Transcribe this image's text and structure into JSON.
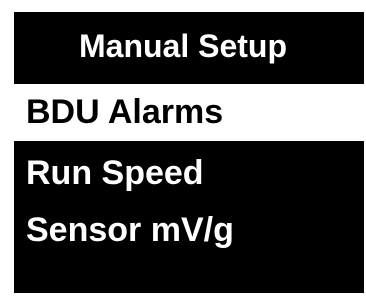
{
  "screen": {
    "title": "Manual Setup",
    "menu": [
      {
        "label": "BDU Alarms",
        "selected": true
      },
      {
        "label": "Run Speed",
        "selected": false
      },
      {
        "label": "Sensor mV/g",
        "selected": false
      }
    ]
  },
  "colors": {
    "background": "#000000",
    "text": "#ffffff",
    "highlight_background": "#ffffff",
    "highlight_text": "#000000"
  }
}
